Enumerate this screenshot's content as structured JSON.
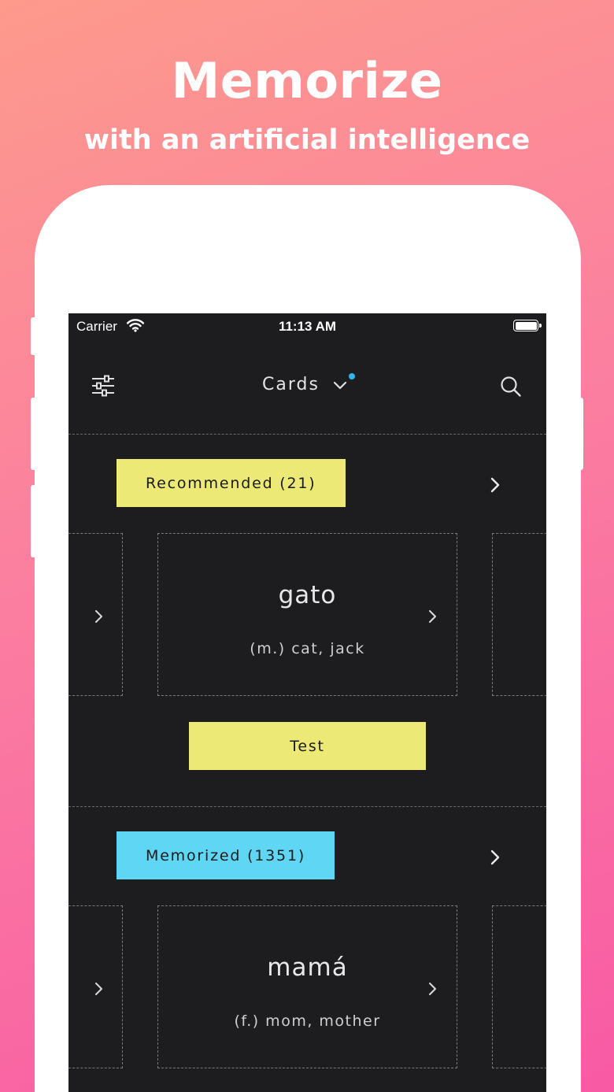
{
  "promo": {
    "headline": "Memorize",
    "subheadline": "with an artificial intelligence"
  },
  "status_bar": {
    "carrier": "Carrier",
    "time": "11:13 AM",
    "icons": [
      "wifi-icon",
      "battery-icon"
    ]
  },
  "nav": {
    "title": "Cards",
    "left_icon": "filter-sliders-icon",
    "title_icon": "chevron-down-icon",
    "badge_color": "#2eb7ec",
    "right_icon": "search-icon"
  },
  "sections": [
    {
      "label": "Recommended (21)",
      "color": "#ede977",
      "card": {
        "word": "gato",
        "meaning": "(m.) cat, jack"
      },
      "action_label": "Test"
    },
    {
      "label": "Memorized (1351)",
      "color": "#5fd6f4",
      "card": {
        "word": "mamá",
        "meaning": "(f.) mom, mother"
      }
    }
  ],
  "colors": {
    "background_gradient": [
      "#fd9a8c",
      "#f85aa4"
    ],
    "screen_bg": "#1d1d1f"
  }
}
